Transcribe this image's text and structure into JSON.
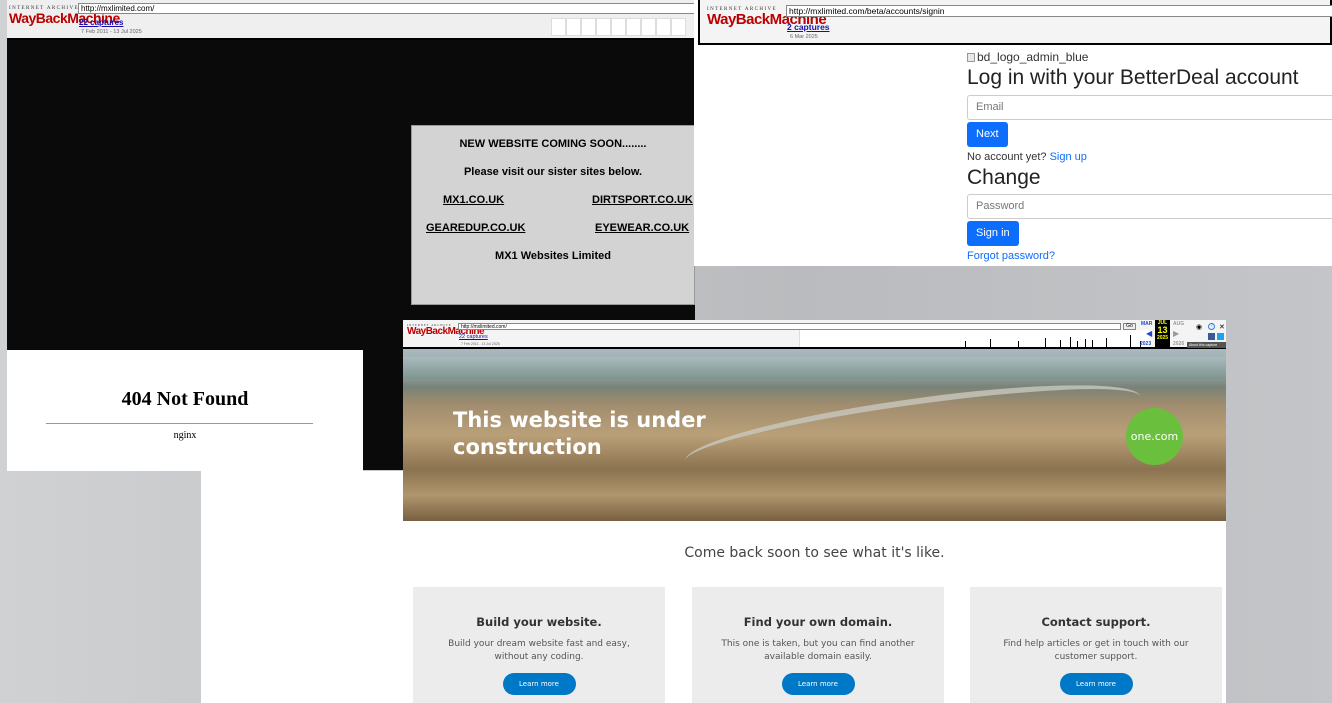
{
  "win1": {
    "wayback": {
      "brand_top": "INTERNET ARCHIVE",
      "brand": "WayBackMachine",
      "url": "http://mxlimited.com/",
      "captures": "22 captures",
      "dates": "7 Feb 2011 - 13 Jul 2025"
    },
    "notice": {
      "heading": "NEW WEBSITE COMING SOON........",
      "subheading": "Please visit our sister sites below.",
      "links": [
        "MX1.CO.UK",
        "DIRTSPORT.CO.UK",
        "GEAREDUP.CO.UK",
        "EYEWEAR.CO.UK"
      ],
      "company": "MX1 Websites Limited"
    },
    "not_found": {
      "title": "404 Not Found",
      "server": "nginx"
    }
  },
  "win2": {
    "wayback": {
      "brand_top": "INTERNET ARCHIVE",
      "brand": "WayBackMachine",
      "url": "http://mxlimited.com/beta/accounts/signin",
      "captures": "2 captures",
      "dates": "6 Mar 2025"
    },
    "logo_alt": "bd_logo_admin_blue",
    "title": "Log in with your BetterDeal account",
    "email_placeholder": "Email",
    "next": "Next",
    "no_account": "No account yet?",
    "signup": "Sign up",
    "change": "Change",
    "password_placeholder": "Password",
    "signin": "Sign in",
    "forgot": "Forgot password?"
  },
  "win4": {
    "wayback": {
      "brand_top": "INTERNET ARCHIVE",
      "brand": "WayBackMachine",
      "url": "http://mxlimited.com/",
      "captures": "22 captures",
      "dates": "7 Feb 2011 - 13 Jul 2025",
      "go": "Go",
      "month_prev": "MAR",
      "month_cur": "JUL",
      "month_next": "AUG",
      "day": "13",
      "year_prev": "2023",
      "year_cur": "2025",
      "year_next": "2026",
      "about": "About this capture"
    },
    "hero_title": "This website is under construction",
    "brand_badge": "one.com",
    "tagline": "Come back soon to see what it's like.",
    "cards": [
      {
        "title": "Build your website.",
        "text": "Build your dream website fast and easy, without any coding.",
        "button": "Learn more"
      },
      {
        "title": "Find your own domain.",
        "text": "This one is taken, but you can find another available domain easily.",
        "button": "Learn more"
      },
      {
        "title": "Contact support.",
        "text": "Find help articles or get in touch with our customer support.",
        "button": "Learn more"
      }
    ]
  }
}
